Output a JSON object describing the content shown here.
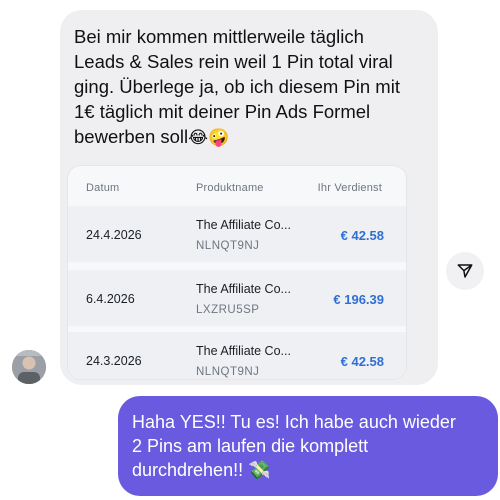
{
  "incoming_message": {
    "text": "Bei mir kommen mittlerweile täglich\nLeads & Sales rein weil 1 Pin total viral\nging. Überlege ja, ob ich diesem Pin mit\n1€ täglich mit deiner Pin Ads Formel\nbewerben soll",
    "emojis": "😂🤪"
  },
  "earnings_table": {
    "headers": {
      "date": "Datum",
      "product": "Produktname",
      "earnings": "Ihr Verdienst"
    },
    "rows": [
      {
        "date": "24.4.2026",
        "product": "The Affiliate Co...",
        "code": "NLNQT9NJ",
        "earnings": "€ 42.58"
      },
      {
        "date": "6.4.2026",
        "product": "The Affiliate Co...",
        "code": "LXZRU5SP",
        "earnings": "€ 196.39"
      },
      {
        "date": "24.3.2026",
        "product": "The Affiliate Co...",
        "code": "NLNQT9NJ",
        "earnings": "€ 42.58"
      }
    ]
  },
  "outgoing_message": {
    "text": "Haha YES!! Tu es! Ich habe auch wieder\n2 Pins am laufen die komplett\ndurchdrehen!! ",
    "emoji": "💸"
  },
  "icons": {
    "share": "paper-plane-icon",
    "avatar": "user-avatar"
  },
  "colors": {
    "incoming_bubble": "#efeff1",
    "outgoing_bubble": "#6a5ae0",
    "earnings_text": "#2f6fd3"
  }
}
